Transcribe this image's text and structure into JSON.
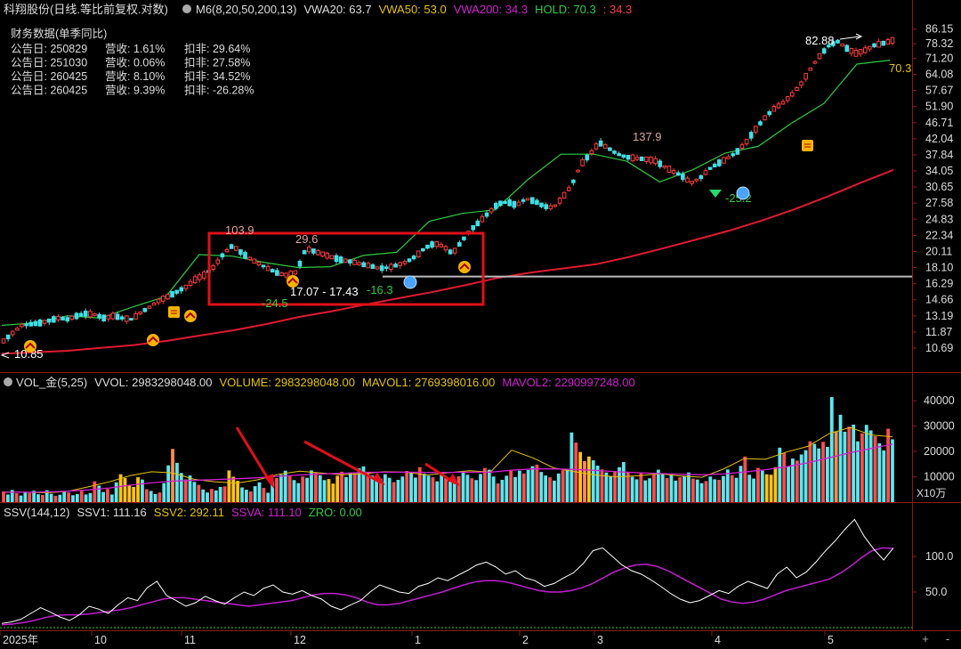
{
  "header": {
    "title": "科翔股份(日线.等比前复权.对数)",
    "items": [
      {
        "label": "M6(8,20,50,200,13)",
        "color": "#dddddd"
      },
      {
        "label": "VWA20: 63.7",
        "color": "#dddddd"
      },
      {
        "label": "VWA50: 53.0",
        "color": "#e6c300"
      },
      {
        "label": "VWA200: 34.3",
        "color": "#d21ed2"
      },
      {
        "label": "HOLD: 70.3",
        "color": "#2ecc40"
      },
      {
        "label": ": 34.3",
        "color": "#ff4040"
      }
    ]
  },
  "finance": {
    "title": "财务数据(单季同比)",
    "rows": [
      {
        "date": "公告日: 250829",
        "rev": "营收:  1.61%",
        "deduct": "扣非:  29.64%"
      },
      {
        "date": "公告日: 251030",
        "rev": "营收:  0.06%",
        "deduct": "扣非:  27.58%"
      },
      {
        "date": "公告日: 260425",
        "rev": "营收:  8.10%",
        "deduct": "扣非:  34.52%"
      },
      {
        "date": "公告日: 260425",
        "rev": "营收:  9.39%",
        "deduct": "扣非:  -26.28%"
      }
    ]
  },
  "annotations": {
    "high_marker": "82.88",
    "low_marker": "10.85",
    "peak_label_1": "103.9",
    "peak_label_2": "29.6",
    "peak_label_3": "137.9",
    "low_label_1": "-24.5",
    "low_label_2": "-16.3",
    "low_label_3": "-25.2",
    "range_label": "17.07 - 17.43",
    "hold_value": "70.3"
  },
  "vol_header": [
    {
      "label": "VOL_金(5,25)",
      "color": "#dddddd"
    },
    {
      "label": "VVOL: 2983298048.00",
      "color": "#dddddd"
    },
    {
      "label": "VOLUME: 2983298048.00",
      "color": "#e6c300"
    },
    {
      "label": "MAVOL1: 2769398016.00",
      "color": "#e6c300"
    },
    {
      "label": "MAVOL2: 2290997248.00",
      "color": "#d21ed2"
    }
  ],
  "ssv_header": [
    {
      "label": "SSV(144,12)",
      "color": "#dddddd"
    },
    {
      "label": "SSV1: 111.16",
      "color": "#dddddd"
    },
    {
      "label": "SSV2: 292.11",
      "color": "#e6c300"
    },
    {
      "label": "SSVA: 111.10",
      "color": "#d21ed2"
    },
    {
      "label": "ZRO: 0.00",
      "color": "#2ecc40"
    }
  ],
  "vol_unit": "X10万",
  "x_axis_labels": [
    "2025年",
    "10",
    "11",
    "12",
    "1",
    "2",
    "3",
    "4",
    "5"
  ],
  "buttons": {
    "plus": "+",
    "minus": "-"
  },
  "chart_data": [
    {
      "type": "candlestick",
      "title": "科翔股份(日线.等比前复权.对数)",
      "y_scale": "log",
      "ylim": [
        10.2,
        87
      ],
      "y_ticks": [
        86.15,
        78.32,
        71.2,
        64.08,
        57.67,
        51.9,
        46.71,
        42.04,
        37.84,
        34.05,
        30.65,
        27.58,
        24.83,
        22.34,
        20.11,
        18.1,
        16.29,
        14.66,
        13.19,
        11.87,
        10.69
      ],
      "x_ticks": [
        "2025年",
        "10",
        "11",
        "12",
        "1",
        "2",
        "3",
        "4",
        "5"
      ],
      "price_path": [
        11.2,
        11.8,
        12.4,
        12.5,
        12.6,
        12.8,
        13.0,
        12.9,
        13.2,
        13.4,
        13.3,
        13.0,
        13.2,
        13.0,
        12.9,
        13.5,
        14.0,
        14.6,
        15.0,
        15.5,
        16.0,
        16.8,
        17.3,
        18.2,
        19.8,
        20.9,
        19.9,
        19.1,
        18.5,
        17.9,
        17.4,
        17.2,
        17.6,
        20.5,
        20.1,
        19.7,
        19.3,
        19.0,
        18.8,
        18.5,
        18.3,
        18.0,
        18.1,
        18.4,
        18.8,
        19.5,
        20.6,
        21.2,
        20.8,
        19.8,
        21.5,
        23.2,
        24.5,
        26.0,
        27.5,
        27.8,
        27.2,
        28.4,
        27.9,
        27.0,
        26.8,
        28.6,
        31.0,
        35.5,
        38.0,
        41.0,
        39.5,
        38.0,
        37.3,
        37.0,
        36.8,
        36.5,
        35.2,
        34.0,
        33.0,
        31.5,
        32.5,
        34.5,
        35.8,
        37.0,
        38.5,
        41.0,
        44.5,
        48.0,
        51.0,
        53.0,
        56.0,
        60.0,
        66.0,
        72.0,
        77.0,
        79.5,
        76.0,
        73.5,
        75.0,
        77.5,
        78.5,
        80.0
      ],
      "vwa200_path": [
        10.3,
        10.4,
        10.5,
        10.7,
        10.9,
        11.2,
        11.6,
        12.0,
        12.5,
        13.1,
        13.6,
        14.2,
        14.8,
        15.4,
        16.1,
        16.9,
        17.5,
        18.0,
        18.5,
        19.4,
        20.5,
        21.7,
        23.0,
        24.6,
        26.5,
        28.8,
        31.5,
        34.3
      ],
      "hold_path": [
        12.4,
        12.6,
        13.2,
        13.0,
        14.0,
        15.0,
        19.7,
        19.5,
        18.7,
        18.1,
        18.2,
        19.6,
        20.0,
        24.5,
        25.8,
        26.4,
        32.2,
        38.0,
        38.0,
        36.3,
        31.7,
        34.3,
        38.3,
        40.0,
        46.5,
        53.0,
        68.5,
        70.3
      ],
      "horizontal_line": 17.07,
      "price_labels": {
        "high": 82.88,
        "low": 10.85
      }
    },
    {
      "type": "bar",
      "title": "VOL_金(5,25)",
      "unit": "X10万",
      "y_ticks": [
        40000,
        30000,
        20000,
        10000
      ],
      "ylim": [
        0,
        45000
      ],
      "values": [
        4200,
        3000,
        4800,
        3500,
        2600,
        3900,
        3600,
        4500,
        3100,
        2800,
        4700,
        3300,
        2500,
        2900,
        4100,
        3800,
        2700,
        3200,
        4400,
        3000,
        3600,
        8200,
        6500,
        4000,
        5200,
        3000,
        7800,
        11000,
        9500,
        6600,
        6000,
        9800,
        8900,
        5100,
        4400,
        3200,
        3800,
        7500,
        14500,
        21000,
        15500,
        11500,
        9000,
        10500,
        8000,
        6800,
        5000,
        3800,
        5200,
        4600,
        6000,
        6200,
        12500,
        10000,
        8400,
        5800,
        4900,
        4200,
        6300,
        7800,
        5600,
        3700,
        8200,
        9500,
        10800,
        12400,
        10300,
        8700,
        7500,
        10100,
        9600,
        12500,
        11800,
        10600,
        8700,
        9100,
        7300,
        10400,
        12000,
        9900,
        11700,
        11400,
        13300,
        14100,
        12000,
        10500,
        8900,
        9300,
        11000,
        9600,
        7900,
        8800,
        10100,
        12300,
        11800,
        9700,
        13800,
        11200,
        10400,
        9800,
        8200,
        11500,
        9500,
        8100,
        7600,
        10200,
        12100,
        10800,
        9400,
        8700,
        11100,
        13500,
        12800,
        10100,
        7400,
        8800,
        10400,
        12800,
        9900,
        12400,
        11300,
        12700,
        14200,
        14800,
        11900,
        10500,
        9800,
        8500,
        11300,
        12600,
        13100,
        27500,
        23500,
        19800,
        16200,
        18000,
        16500,
        14400,
        12900,
        11700,
        10300,
        12200,
        13800,
        15800,
        12000,
        10000,
        9000,
        11600,
        8600,
        9400,
        10900,
        12800,
        11200,
        9500,
        10800,
        8500,
        9800,
        10400,
        11700,
        9300,
        8900,
        7500,
        8300,
        10100,
        9000,
        8800,
        10300,
        12900,
        10600,
        9600,
        14300,
        18000,
        10800,
        9300,
        13500,
        12400,
        11000,
        10800,
        13800,
        21500,
        19500,
        14200,
        17200,
        16400,
        18800,
        20500,
        24000,
        23000,
        21200,
        23800,
        21800,
        41500,
        28000,
        34500,
        27800,
        29800,
        30600,
        24000,
        27200,
        30500,
        28300,
        26000,
        23200,
        20400,
        29000,
        24800
      ],
      "mavol1_path": [
        4000,
        3900,
        3700,
        4200,
        6000,
        8000,
        10500,
        12000,
        11500,
        9000,
        8000,
        7500,
        8800,
        11000,
        12200,
        11500,
        10800,
        11200,
        12000,
        11800,
        10700,
        11600,
        12400,
        11900,
        20500,
        17500,
        13500,
        12000,
        10600,
        10000,
        10400,
        11200,
        10300,
        9800,
        13000,
        17200,
        16900,
        19800,
        22000,
        27000,
        29500,
        26500,
        25800
      ],
      "mavol2_path": [
        3900,
        3900,
        4000,
        4300,
        4800,
        5600,
        6700,
        7600,
        8300,
        8600,
        8900,
        9200,
        9600,
        10200,
        10700,
        11100,
        11400,
        11700,
        11800,
        11800,
        11700,
        11700,
        11800,
        11800,
        12600,
        13100,
        13100,
        12900,
        12500,
        12000,
        11600,
        11300,
        11000,
        10800,
        11100,
        11900,
        12800,
        14000,
        15500,
        17500,
        19500,
        21200,
        22900
      ]
    },
    {
      "type": "line",
      "title": "SSV(144,12)",
      "y_ticks": [
        100.0,
        50.0
      ],
      "ylim": [
        0,
        150
      ],
      "series": [
        {
          "name": "SSV1",
          "values": [
            6,
            8,
            12,
            20,
            28,
            22,
            15,
            10,
            18,
            30,
            26,
            20,
            32,
            42,
            38,
            56,
            65,
            45,
            38,
            30,
            35,
            44,
            38,
            33,
            42,
            50,
            45,
            55,
            60,
            50,
            47,
            52,
            45,
            40,
            30,
            25,
            32,
            38,
            50,
            60,
            55,
            50,
            48,
            58,
            62,
            70,
            66,
            73,
            80,
            88,
            92,
            85,
            75,
            80,
            70,
            66,
            58,
            62,
            70,
            77,
            90,
            108,
            112,
            100,
            88,
            80,
            75,
            67,
            58,
            48,
            40,
            35,
            38,
            45,
            52,
            48,
            58,
            65,
            60,
            55,
            75,
            85,
            70,
            78,
            92,
            108,
            122,
            138,
            152,
            128,
            110,
            95,
            112
          ]
        },
        {
          "name": "SSVA",
          "values": [
            4,
            5,
            7,
            10,
            14,
            17,
            18,
            18,
            19,
            21,
            23,
            25,
            28,
            32,
            36,
            40,
            42,
            42,
            40,
            38,
            36,
            34,
            32,
            30,
            32,
            34,
            36,
            38,
            42,
            46,
            48,
            48,
            46,
            42,
            36,
            32,
            32,
            34,
            38,
            42,
            46,
            50,
            55,
            60,
            64,
            66,
            66,
            64,
            60,
            56,
            52,
            50,
            50,
            52,
            56,
            62,
            70,
            78,
            84,
            88,
            89,
            86,
            80,
            72,
            64,
            56,
            48,
            40,
            36,
            34,
            36,
            40,
            46,
            52,
            56,
            60,
            64,
            68,
            76,
            86,
            98,
            108,
            112,
            111.1
          ]
        }
      ]
    }
  ]
}
